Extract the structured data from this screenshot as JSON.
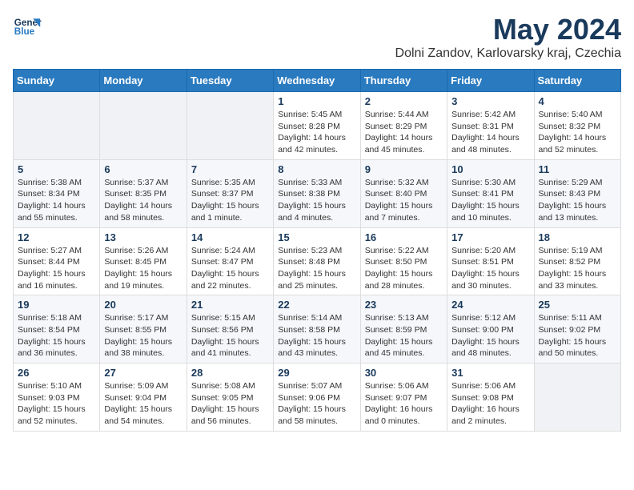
{
  "logo": {
    "line1": "General",
    "line2": "Blue"
  },
  "title": "May 2024",
  "location": "Dolni Zandov, Karlovarsky kraj, Czechia",
  "days_header": [
    "Sunday",
    "Monday",
    "Tuesday",
    "Wednesday",
    "Thursday",
    "Friday",
    "Saturday"
  ],
  "weeks": [
    [
      {
        "day": "",
        "info": ""
      },
      {
        "day": "",
        "info": ""
      },
      {
        "day": "",
        "info": ""
      },
      {
        "day": "1",
        "info": "Sunrise: 5:45 AM\nSunset: 8:28 PM\nDaylight: 14 hours\nand 42 minutes."
      },
      {
        "day": "2",
        "info": "Sunrise: 5:44 AM\nSunset: 8:29 PM\nDaylight: 14 hours\nand 45 minutes."
      },
      {
        "day": "3",
        "info": "Sunrise: 5:42 AM\nSunset: 8:31 PM\nDaylight: 14 hours\nand 48 minutes."
      },
      {
        "day": "4",
        "info": "Sunrise: 5:40 AM\nSunset: 8:32 PM\nDaylight: 14 hours\nand 52 minutes."
      }
    ],
    [
      {
        "day": "5",
        "info": "Sunrise: 5:38 AM\nSunset: 8:34 PM\nDaylight: 14 hours\nand 55 minutes."
      },
      {
        "day": "6",
        "info": "Sunrise: 5:37 AM\nSunset: 8:35 PM\nDaylight: 14 hours\nand 58 minutes."
      },
      {
        "day": "7",
        "info": "Sunrise: 5:35 AM\nSunset: 8:37 PM\nDaylight: 15 hours\nand 1 minute."
      },
      {
        "day": "8",
        "info": "Sunrise: 5:33 AM\nSunset: 8:38 PM\nDaylight: 15 hours\nand 4 minutes."
      },
      {
        "day": "9",
        "info": "Sunrise: 5:32 AM\nSunset: 8:40 PM\nDaylight: 15 hours\nand 7 minutes."
      },
      {
        "day": "10",
        "info": "Sunrise: 5:30 AM\nSunset: 8:41 PM\nDaylight: 15 hours\nand 10 minutes."
      },
      {
        "day": "11",
        "info": "Sunrise: 5:29 AM\nSunset: 8:43 PM\nDaylight: 15 hours\nand 13 minutes."
      }
    ],
    [
      {
        "day": "12",
        "info": "Sunrise: 5:27 AM\nSunset: 8:44 PM\nDaylight: 15 hours\nand 16 minutes."
      },
      {
        "day": "13",
        "info": "Sunrise: 5:26 AM\nSunset: 8:45 PM\nDaylight: 15 hours\nand 19 minutes."
      },
      {
        "day": "14",
        "info": "Sunrise: 5:24 AM\nSunset: 8:47 PM\nDaylight: 15 hours\nand 22 minutes."
      },
      {
        "day": "15",
        "info": "Sunrise: 5:23 AM\nSunset: 8:48 PM\nDaylight: 15 hours\nand 25 minutes."
      },
      {
        "day": "16",
        "info": "Sunrise: 5:22 AM\nSunset: 8:50 PM\nDaylight: 15 hours\nand 28 minutes."
      },
      {
        "day": "17",
        "info": "Sunrise: 5:20 AM\nSunset: 8:51 PM\nDaylight: 15 hours\nand 30 minutes."
      },
      {
        "day": "18",
        "info": "Sunrise: 5:19 AM\nSunset: 8:52 PM\nDaylight: 15 hours\nand 33 minutes."
      }
    ],
    [
      {
        "day": "19",
        "info": "Sunrise: 5:18 AM\nSunset: 8:54 PM\nDaylight: 15 hours\nand 36 minutes."
      },
      {
        "day": "20",
        "info": "Sunrise: 5:17 AM\nSunset: 8:55 PM\nDaylight: 15 hours\nand 38 minutes."
      },
      {
        "day": "21",
        "info": "Sunrise: 5:15 AM\nSunset: 8:56 PM\nDaylight: 15 hours\nand 41 minutes."
      },
      {
        "day": "22",
        "info": "Sunrise: 5:14 AM\nSunset: 8:58 PM\nDaylight: 15 hours\nand 43 minutes."
      },
      {
        "day": "23",
        "info": "Sunrise: 5:13 AM\nSunset: 8:59 PM\nDaylight: 15 hours\nand 45 minutes."
      },
      {
        "day": "24",
        "info": "Sunrise: 5:12 AM\nSunset: 9:00 PM\nDaylight: 15 hours\nand 48 minutes."
      },
      {
        "day": "25",
        "info": "Sunrise: 5:11 AM\nSunset: 9:02 PM\nDaylight: 15 hours\nand 50 minutes."
      }
    ],
    [
      {
        "day": "26",
        "info": "Sunrise: 5:10 AM\nSunset: 9:03 PM\nDaylight: 15 hours\nand 52 minutes."
      },
      {
        "day": "27",
        "info": "Sunrise: 5:09 AM\nSunset: 9:04 PM\nDaylight: 15 hours\nand 54 minutes."
      },
      {
        "day": "28",
        "info": "Sunrise: 5:08 AM\nSunset: 9:05 PM\nDaylight: 15 hours\nand 56 minutes."
      },
      {
        "day": "29",
        "info": "Sunrise: 5:07 AM\nSunset: 9:06 PM\nDaylight: 15 hours\nand 58 minutes."
      },
      {
        "day": "30",
        "info": "Sunrise: 5:06 AM\nSunset: 9:07 PM\nDaylight: 16 hours\nand 0 minutes."
      },
      {
        "day": "31",
        "info": "Sunrise: 5:06 AM\nSunset: 9:08 PM\nDaylight: 16 hours\nand 2 minutes."
      },
      {
        "day": "",
        "info": ""
      }
    ]
  ]
}
